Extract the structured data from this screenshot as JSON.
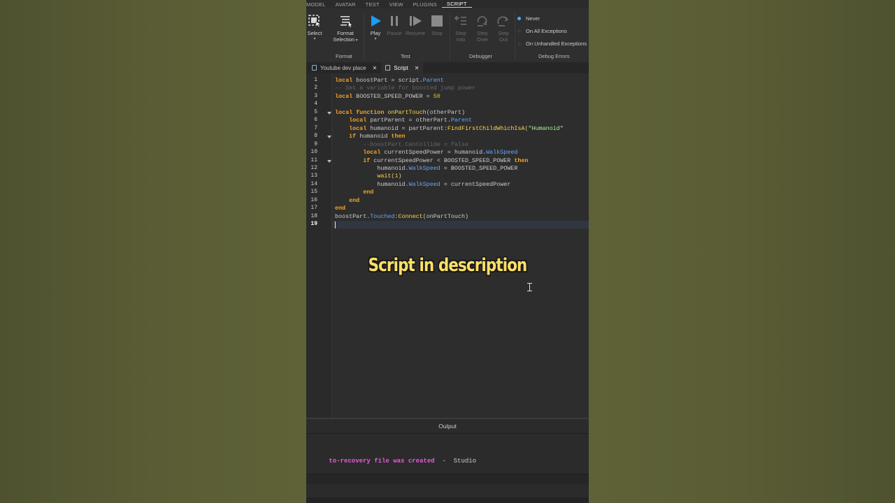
{
  "menu": {
    "items": [
      "MODEL",
      "AVATAR",
      "TEST",
      "VIEW",
      "PLUGINS",
      "SCRIPT"
    ],
    "active_index": 5
  },
  "ribbon": {
    "tools": {
      "select": "Select",
      "format_line1": "Format",
      "format_line2": "Selection",
      "play": "Play",
      "pause": "Pause",
      "resume": "Resume",
      "stop": "Stop",
      "step_into_1": "Step",
      "step_into_2": "Into",
      "step_over_1": "Step",
      "step_over_2": "Over",
      "step_out_1": "Step",
      "step_out_2": "Out"
    },
    "groups": {
      "format": "Format",
      "test": "Test",
      "debugger": "Debugger",
      "debug_errors": "Debug Errors"
    },
    "debug_options": [
      "Never",
      "On All Exceptions",
      "On Unhandled Exceptions"
    ],
    "debug_selected": "Never"
  },
  "tabs": [
    {
      "label": "Youtube dev place",
      "active": false
    },
    {
      "label": "Script",
      "active": true
    }
  ],
  "editor": {
    "current_line": 19,
    "lines": [
      [
        [
          "kw",
          "local"
        ],
        [
          "plain",
          " boostPart = script."
        ],
        [
          "prop",
          "Parent"
        ]
      ],
      [
        [
          "cmt",
          "-- Set a variable for boosted jump power"
        ]
      ],
      [
        [
          "kw",
          "local"
        ],
        [
          "plain",
          " BOOSTED_SPEED_POWER = "
        ],
        [
          "num",
          "50"
        ]
      ],
      [],
      [
        [
          "kw",
          "local function"
        ],
        [
          "plain",
          " "
        ],
        [
          "fn",
          "onPartTouch"
        ],
        [
          "plain",
          "(otherPart)"
        ]
      ],
      [
        [
          "plain",
          "    "
        ],
        [
          "kw",
          "local"
        ],
        [
          "plain",
          " partParent = otherPart."
        ],
        [
          "prop",
          "Parent"
        ]
      ],
      [
        [
          "plain",
          "    "
        ],
        [
          "kw",
          "local"
        ],
        [
          "plain",
          " humanoid = partParent:"
        ],
        [
          "fn",
          "FindFirstChildWhichIsA"
        ],
        [
          "plain",
          "("
        ],
        [
          "str",
          "\"Humanoid\""
        ]
      ],
      [
        [
          "plain",
          "    "
        ],
        [
          "kw",
          "if"
        ],
        [
          "plain",
          " humanoid "
        ],
        [
          "kw",
          "then"
        ]
      ],
      [
        [
          "plain",
          "        "
        ],
        [
          "cmt",
          "--boostPart.CanCollide = false"
        ]
      ],
      [
        [
          "plain",
          "        "
        ],
        [
          "kw",
          "local"
        ],
        [
          "plain",
          " currentSpeedPower = humanoid."
        ],
        [
          "prop",
          "WalkSpeed"
        ]
      ],
      [
        [
          "plain",
          "        "
        ],
        [
          "kw",
          "if"
        ],
        [
          "plain",
          " currentSpeedPower < BOOSTED_SPEED_POWER "
        ],
        [
          "kw",
          "then"
        ]
      ],
      [
        [
          "plain",
          "            humanoid."
        ],
        [
          "prop",
          "WalkSpeed"
        ],
        [
          "plain",
          " = BOOSTED_SPEED_POWER"
        ]
      ],
      [
        [
          "plain",
          "            "
        ],
        [
          "fn",
          "wait"
        ],
        [
          "plain",
          "("
        ],
        [
          "num",
          "1"
        ],
        [
          "plain",
          ")"
        ]
      ],
      [
        [
          "plain",
          "            humanoid."
        ],
        [
          "prop",
          "WalkSpeed"
        ],
        [
          "plain",
          " = currentSpeedPower"
        ]
      ],
      [
        [
          "plain",
          "        "
        ],
        [
          "kw",
          "end"
        ]
      ],
      [
        [
          "plain",
          "    "
        ],
        [
          "kw",
          "end"
        ]
      ],
      [
        [
          "kw",
          "end"
        ]
      ],
      [
        [
          "plain",
          "boostPart."
        ],
        [
          "prop",
          "Touched"
        ],
        [
          "plain",
          ":"
        ],
        [
          "fn",
          "Connect"
        ],
        [
          "plain",
          "(onPartTouch)"
        ]
      ],
      []
    ],
    "fold_lines": [
      5,
      8,
      11
    ]
  },
  "caption": "Script in description",
  "output": {
    "title": "Output",
    "message": "to-recovery file was created",
    "separator": "  -  ",
    "source": "Studio"
  },
  "colors": {
    "keyword": "#f5a623",
    "property": "#61a8ff",
    "number": "#ffc600",
    "string": "#adf195",
    "comment": "#5f6670",
    "caption": "#ffe066",
    "output_message": "#e65cd9"
  }
}
